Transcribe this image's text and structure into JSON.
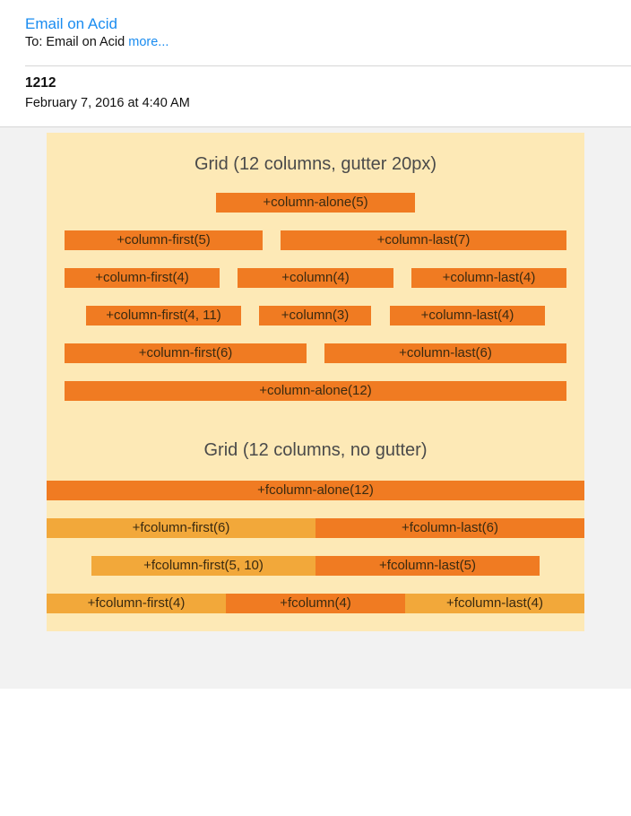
{
  "email": {
    "sender": "Email on Acid",
    "to_prefix": "To: Email on Acid",
    "more_link": "more...",
    "subject": "1212",
    "date": "February 7, 2016 at 4:40 AM"
  },
  "grid_gutter": {
    "title": "Grid (12 columns, gutter 20px)",
    "rows": [
      [
        "+column-alone(5)"
      ],
      [
        "+column-first(5)",
        "+column-last(7)"
      ],
      [
        "+column-first(4)",
        "+column(4)",
        "+column-last(4)"
      ],
      [
        "+column-first(4, 11)",
        "+column(3)",
        "+column-last(4)"
      ],
      [
        "+column-first(6)",
        "+column-last(6)"
      ],
      [
        "+column-alone(12)"
      ]
    ]
  },
  "grid_nogutter": {
    "title": "Grid (12 columns, no gutter)",
    "rows": [
      [
        "+fcolumn-alone(12)"
      ],
      [
        "+fcolumn-first(6)",
        "+fcolumn-last(6)"
      ],
      [
        "+fcolumn-first(5, 10)",
        "+fcolumn-last(5)"
      ],
      [
        "+fcolumn-first(4)",
        "+fcolumn(4)",
        "+fcolumn-last(4)"
      ]
    ]
  },
  "colors": {
    "cell_dark": "#f07b22",
    "cell_light": "#f2a83a",
    "canvas_bg": "#fde9b6",
    "link": "#1a8cf0"
  }
}
